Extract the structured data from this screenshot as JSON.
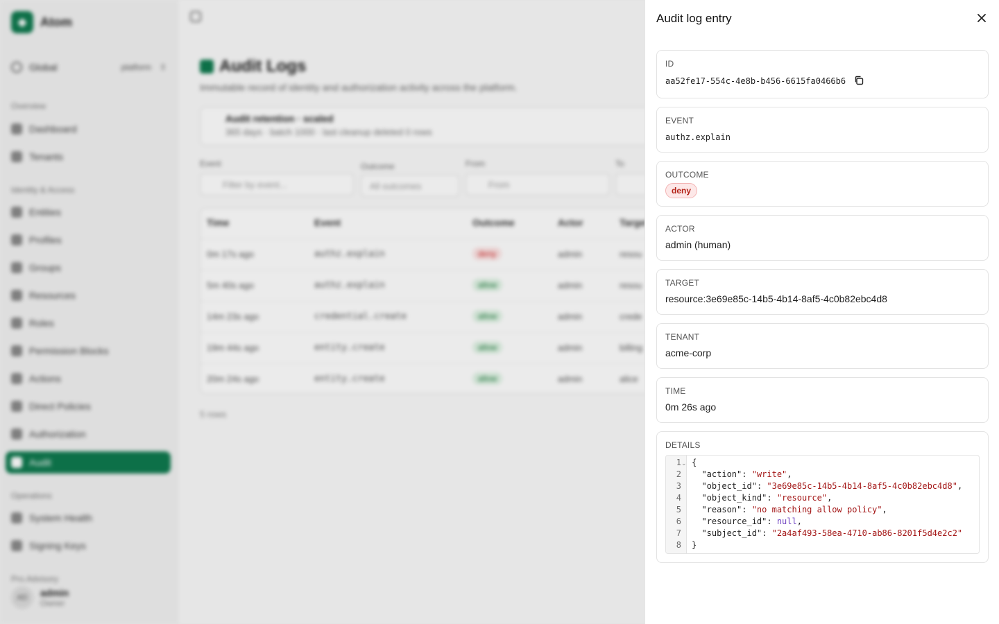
{
  "app": {
    "brand": "Atom",
    "scope": {
      "name": "Global",
      "tag": "platform"
    },
    "sidebar": {
      "sections": [
        {
          "title": "Overview",
          "items": [
            "Dashboard",
            "Tenants"
          ]
        },
        {
          "title": "Identity & Access",
          "items": [
            "Entities",
            "Profiles",
            "Groups",
            "Resources",
            "Roles",
            "Permission Blocks",
            "Actions",
            "Direct Policies",
            "Authorization",
            "Audit"
          ]
        },
        {
          "title": "Operations",
          "items": [
            "System Health",
            "Signing Keys"
          ]
        }
      ],
      "active_item": "Audit",
      "footer_section": "Pro.Advisory",
      "user": {
        "initials": "AD",
        "name": "admin",
        "role": "Owner"
      }
    },
    "page": {
      "title": "Audit Logs",
      "subtitle": "Immutable record of identity and authorization activity across the platform.",
      "retention": {
        "title": "Audit retention · scaled",
        "subtitle": "365 days · batch 1000 · last cleanup deleted 0 rows"
      },
      "filters": [
        {
          "label": "Event",
          "placeholder": "Filter by event..."
        },
        {
          "label": "Outcome",
          "placeholder": "All outcomes"
        },
        {
          "label": "From",
          "placeholder": "From"
        },
        {
          "label": "To",
          "placeholder": ""
        }
      ],
      "table": {
        "columns": [
          "Time",
          "Event",
          "Outcome",
          "Actor",
          "Target"
        ],
        "rows": [
          {
            "time": "0m 17s ago",
            "event": "authz.explain",
            "outcome": "deny",
            "actor": "admin",
            "target": "resou"
          },
          {
            "time": "5m 40s ago",
            "event": "authz.explain",
            "outcome": "allow",
            "actor": "admin",
            "target": "resou"
          },
          {
            "time": "14m 23s ago",
            "event": "credential.create",
            "outcome": "allow",
            "actor": "admin",
            "target": "crede"
          },
          {
            "time": "19m 44s ago",
            "event": "entity.create",
            "outcome": "allow",
            "actor": "admin",
            "target": "billing"
          },
          {
            "time": "20m 24s ago",
            "event": "entity.create",
            "outcome": "allow",
            "actor": "admin",
            "target": "alice"
          }
        ],
        "row_count": "5 rows"
      }
    }
  },
  "drawer": {
    "title": "Audit log entry",
    "fields": {
      "id": {
        "label": "ID",
        "value": "aa52fe17-554c-4e8b-b456-6615fa0466b6"
      },
      "event": {
        "label": "EVENT",
        "value": "authz.explain"
      },
      "outcome": {
        "label": "OUTCOME",
        "value": "deny"
      },
      "actor": {
        "label": "ACTOR",
        "value": "admin (human)"
      },
      "target": {
        "label": "TARGET",
        "value": "resource:3e69e85c-14b5-4b14-8af5-4c0b82ebc4d8"
      },
      "tenant": {
        "label": "TENANT",
        "value": "acme-corp"
      },
      "time": {
        "label": "TIME",
        "value": "0m 26s ago"
      },
      "details": {
        "label": "DETAILS",
        "json": [
          {
            "key": "action",
            "value": "write",
            "type": "string"
          },
          {
            "key": "object_id",
            "value": "3e69e85c-14b5-4b14-8af5-4c0b82ebc4d8",
            "type": "string"
          },
          {
            "key": "object_kind",
            "value": "resource",
            "type": "string"
          },
          {
            "key": "reason",
            "value": "no matching allow policy",
            "type": "string"
          },
          {
            "key": "resource_id",
            "value": "null",
            "type": "null"
          },
          {
            "key": "subject_id",
            "value": "2a4af493-58ea-4710-ab86-8201f5d4e2c2",
            "type": "string"
          }
        ]
      }
    },
    "colors": {
      "accent": "#0f7a4f",
      "deny_bg": "#fde8e8",
      "deny_text": "#b42318",
      "string": "#a31515",
      "null": "#6f42c1"
    }
  }
}
